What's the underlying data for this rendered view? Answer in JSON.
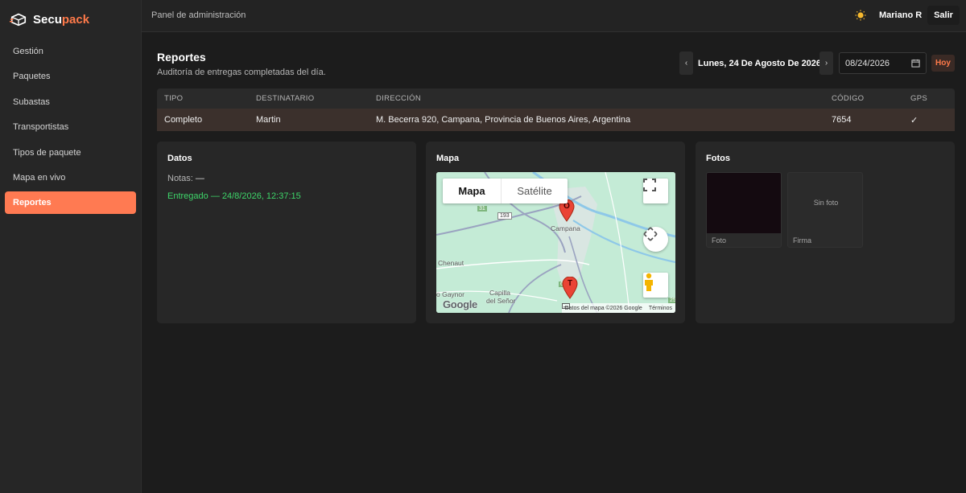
{
  "brand": {
    "name_main": "Secu",
    "name_accent": "pack",
    "accent_color": "#ff7a4a"
  },
  "sidebar": {
    "items": [
      {
        "label": "Gestión"
      },
      {
        "label": "Paquetes"
      },
      {
        "label": "Subastas"
      },
      {
        "label": "Transportistas"
      },
      {
        "label": "Tipos de paquete"
      },
      {
        "label": "Mapa en vivo"
      },
      {
        "label": "Reportes",
        "active": true
      }
    ]
  },
  "header": {
    "title": "Panel de administración",
    "user": "Mariano R",
    "logout_label": "Salir",
    "theme_icon": "sun-icon"
  },
  "page": {
    "title": "Reportes",
    "subtitle": "Auditoría de entregas completadas del día.",
    "date_prev": "‹",
    "date_label": "Lunes, 24 De Agosto De 2026",
    "date_next": "›",
    "date_input_value": "08/24/2026",
    "today_label": "Hoy"
  },
  "table": {
    "columns": [
      "TIPO",
      "DESTINATARIO",
      "DIRECCIÓN",
      "CÓDIGO",
      "GPS"
    ],
    "rows": [
      [
        "Completo",
        "Martin",
        "M. Becerra 920, Campana, Provincia de Buenos Aires, Argentina",
        "7654",
        "✓"
      ]
    ]
  },
  "datos": {
    "title": "Datos",
    "notes_label": "Notas:",
    "notes_value": "—",
    "delivered_text": "Entregado — 24/8/2026, 12:37:15",
    "delivered_color": "#3ed66a"
  },
  "mapa": {
    "title": "Mapa",
    "type_map": "Mapa",
    "type_satellite": "Satélite",
    "labels": [
      "Campana",
      "Chenaut",
      "o Gaynor",
      "Capilla",
      "del Señor"
    ],
    "road_shields": [
      "31",
      "193",
      "6",
      "25"
    ],
    "pins": [
      "O",
      "T"
    ],
    "google": "Google",
    "attribution": "Datos del mapa ©2026 Google",
    "terms": "Términos"
  },
  "fotos": {
    "title": "Fotos",
    "items": [
      {
        "caption": "Foto",
        "has_image": true
      },
      {
        "caption": "Firma",
        "placeholder": "Sin foto"
      }
    ]
  }
}
